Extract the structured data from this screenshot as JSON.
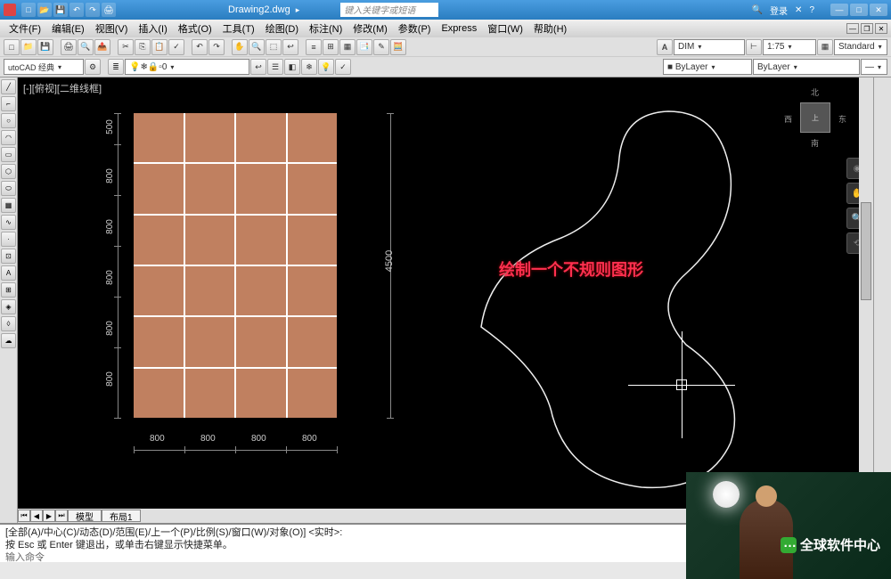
{
  "titlebar": {
    "filename": "Drawing2.dwg",
    "search_placeholder": "键入关键字或短语",
    "login": "登录"
  },
  "menus": [
    "文件(F)",
    "编辑(E)",
    "视图(V)",
    "插入(I)",
    "格式(O)",
    "工具(T)",
    "绘图(D)",
    "标注(N)",
    "修改(M)",
    "参数(P)",
    "Express",
    "窗口(W)",
    "帮助(H)"
  ],
  "toolbar_combos": {
    "dimstyle": "DIM",
    "scale": "1:75",
    "textstyle": "Standard",
    "layer_prefix": "utoCAD 经典",
    "layer": "0",
    "color": "■ ByLayer",
    "linetype": "ByLayer"
  },
  "viewport_label": "[-][俯视][二维线框]",
  "dimensions": {
    "left_rows": [
      "500",
      "800",
      "800",
      "800",
      "800",
      "800"
    ],
    "bottom_cols": [
      "800",
      "800",
      "800",
      "800"
    ],
    "right_total": "4500"
  },
  "annotation_text": "绘制一个不规则图形",
  "viewcube": {
    "top": "北",
    "right": "东",
    "bottom": "南",
    "left": "西",
    "face": "上"
  },
  "tabs": {
    "model": "模型",
    "layout1": "布局1"
  },
  "cmdline": {
    "line1": "[全部(A)/中心(C)/动态(D)/范围(E)/上一个(P)/比例(S)/窗口(W)/对象(O)] <实时>:",
    "line2": "按 Esc 或 Enter 键退出，或单击右键显示快捷菜单。",
    "line3": "输入命令"
  },
  "watermark": {
    "brand": "全球软件中心"
  }
}
